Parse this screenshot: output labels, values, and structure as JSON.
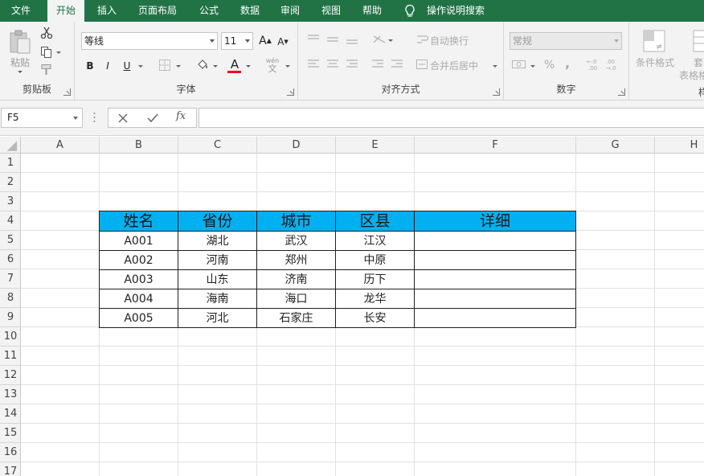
{
  "ribbon": {
    "tabs": [
      {
        "label": "文件",
        "active": false
      },
      {
        "label": "开始",
        "active": true
      },
      {
        "label": "插入",
        "active": false
      },
      {
        "label": "页面布局",
        "active": false
      },
      {
        "label": "公式",
        "active": false
      },
      {
        "label": "数据",
        "active": false
      },
      {
        "label": "审阅",
        "active": false
      },
      {
        "label": "视图",
        "active": false
      },
      {
        "label": "帮助",
        "active": false
      }
    ],
    "search_label": "操作说明搜索",
    "groups": {
      "clipboard": {
        "label": "剪贴板",
        "paste_label": "粘贴"
      },
      "font": {
        "label": "字体",
        "font_name": "等线",
        "font_size": "11",
        "bold": "B",
        "italic": "I",
        "underline": "U",
        "phonetic_top": "wén",
        "phonetic_bottom": "文"
      },
      "alignment": {
        "label": "对齐方式",
        "wrap_text": "自动换行",
        "merge_center": "合并后居中"
      },
      "number": {
        "label": "数字",
        "format": "常规",
        "percent": "%",
        "comma": ","
      },
      "styles": {
        "conditional_format": "条件格式",
        "table_format_top": "套",
        "table_format_bottom": "表格格",
        "cut_label": "样"
      }
    },
    "colors": {
      "tab_bg": "#217346",
      "font_color_bar": "#e81123",
      "header_fill": "#00b0f0"
    }
  },
  "formula_bar": {
    "name_box": "F5",
    "fx": "fx",
    "formula": ""
  },
  "sheet": {
    "columns": [
      "A",
      "B",
      "C",
      "D",
      "E",
      "F",
      "G",
      "H"
    ],
    "rows": [
      "1",
      "2",
      "3",
      "4",
      "5",
      "6",
      "7",
      "8",
      "9",
      "10",
      "11",
      "12",
      "13",
      "14",
      "15",
      "16",
      "17"
    ]
  },
  "table": {
    "headers": [
      "姓名",
      "省份",
      "城市",
      "区县",
      "详细"
    ],
    "rows": [
      [
        "A001",
        "湖北",
        "武汉",
        "江汉",
        ""
      ],
      [
        "A002",
        "河南",
        "郑州",
        "中原",
        ""
      ],
      [
        "A003",
        "山东",
        "济南",
        "历下",
        ""
      ],
      [
        "A004",
        "海南",
        "海口",
        "龙华",
        ""
      ],
      [
        "A005",
        "河北",
        "石家庄",
        "长安",
        ""
      ]
    ]
  }
}
